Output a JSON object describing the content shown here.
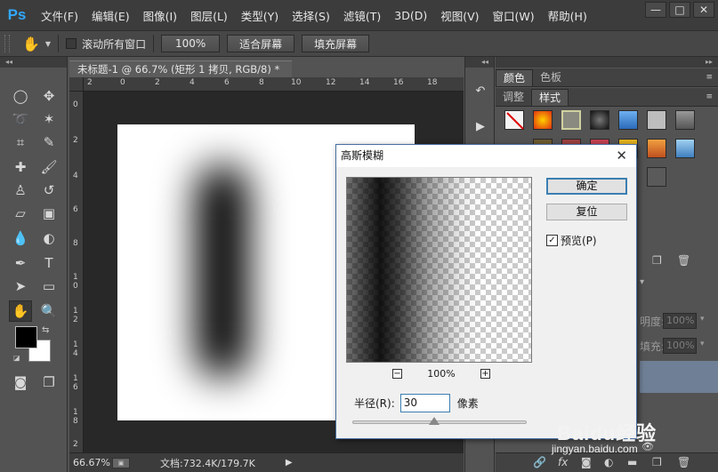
{
  "app": {
    "logo": "Ps",
    "menus": [
      "文件(F)",
      "编辑(E)",
      "图像(I)",
      "图层(L)",
      "类型(Y)",
      "选择(S)",
      "滤镜(T)",
      "3D(D)",
      "视图(V)",
      "窗口(W)",
      "帮助(H)"
    ],
    "window_buttons": [
      "—",
      "□",
      "✕"
    ]
  },
  "options_bar": {
    "scroll_all_label": "滚动所有窗口",
    "zoom_100_label": "100%",
    "fit_screen_label": "适合屏幕",
    "fill_screen_label": "填充屏幕"
  },
  "document": {
    "tab_title": "未标题-1 @ 66.7% (矩形 1 拷贝, RGB/8) *",
    "ruler_top_labels": [
      "2",
      "0",
      "2",
      "4",
      "6",
      "8",
      "10",
      "12",
      "14",
      "16",
      "18"
    ],
    "ruler_left_labels": [
      "0",
      "2",
      "4",
      "6",
      "8",
      "1 0",
      "1 2",
      "1 4",
      "1 6",
      "1 8",
      "2"
    ]
  },
  "status": {
    "zoom": "66.67%",
    "doc_info": "文档:732.4K/179.7K"
  },
  "panels": {
    "tabs_row1": [
      "颜色",
      "色板"
    ],
    "tabs_row2": [
      "调整",
      "样式"
    ],
    "opacity_label": "明度:",
    "opacity_value": "100%",
    "fill_label": "填充:",
    "fill_value": "100%",
    "style_colors": [
      "#f4f4f4",
      "#e04020",
      "#d0d0a0",
      "#303030",
      "#3a7fc8",
      "#bdbdbd",
      "#7c7c7c"
    ],
    "style_colors_row2": [
      "#6a5a30",
      "#9a6a40",
      "#c04040",
      "#d08030",
      "#e0b020",
      "#e08030",
      "#60a0e0"
    ]
  },
  "dialog": {
    "title": "高斯模糊",
    "ok_label": "确定",
    "reset_label": "复位",
    "preview_label": "预览(P)",
    "preview_checked": true,
    "zoom_minus": "−",
    "zoom_value": "100%",
    "zoom_plus": "+",
    "radius_label": "半径(R):",
    "radius_value": "30",
    "radius_unit": "像素",
    "radius_slider_fraction": 0.47
  },
  "watermark": {
    "main": "Baidu经验",
    "url": "jingyan.baidu.com"
  }
}
